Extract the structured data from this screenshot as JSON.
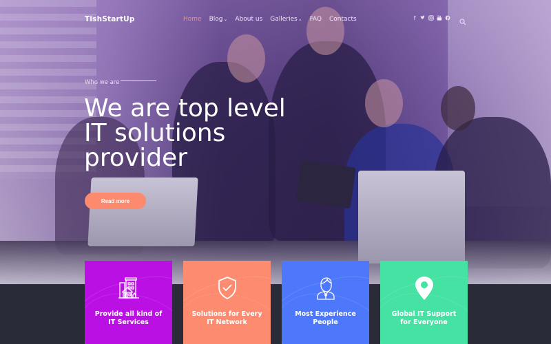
{
  "header": {
    "logo": "TishStartUp",
    "menu": [
      {
        "label": "Home",
        "active": true,
        "has_dropdown": false
      },
      {
        "label": "Blog",
        "active": false,
        "has_dropdown": true
      },
      {
        "label": "About us",
        "active": false,
        "has_dropdown": false
      },
      {
        "label": "Galleries",
        "active": false,
        "has_dropdown": true
      },
      {
        "label": "FAQ",
        "active": false,
        "has_dropdown": false
      },
      {
        "label": "Contacts",
        "active": false,
        "has_dropdown": false
      }
    ],
    "social_icons": [
      "facebook-icon",
      "twitter-icon",
      "instagram-icon",
      "youtube-icon",
      "pinterest-icon"
    ],
    "social_glyphs": [
      "f",
      "t",
      "◎",
      "▶",
      "p"
    ],
    "search_icon": "search-icon",
    "active_color": "#ff8a6b"
  },
  "hero": {
    "eyebrow": "Who we are",
    "headline_lines": [
      "We are top level",
      "IT solutions",
      "provider"
    ],
    "cta_label": "Read more",
    "cta_color": "#fb8a6f"
  },
  "features": [
    {
      "label": "Provide all kind of IT Services",
      "icon": "building-icon",
      "color": "#bb10e4"
    },
    {
      "label": "Solutions for Every IT Network",
      "icon": "shield-check-icon",
      "color": "#fd8b70"
    },
    {
      "label": "Most Experience People",
      "icon": "person-icon",
      "color": "#4e78fc"
    },
    {
      "label": "Global IT Support for Everyone",
      "icon": "map-pin-icon",
      "color": "#46e2a4"
    }
  ],
  "colors": {
    "footer_band": "#2a2b38"
  }
}
